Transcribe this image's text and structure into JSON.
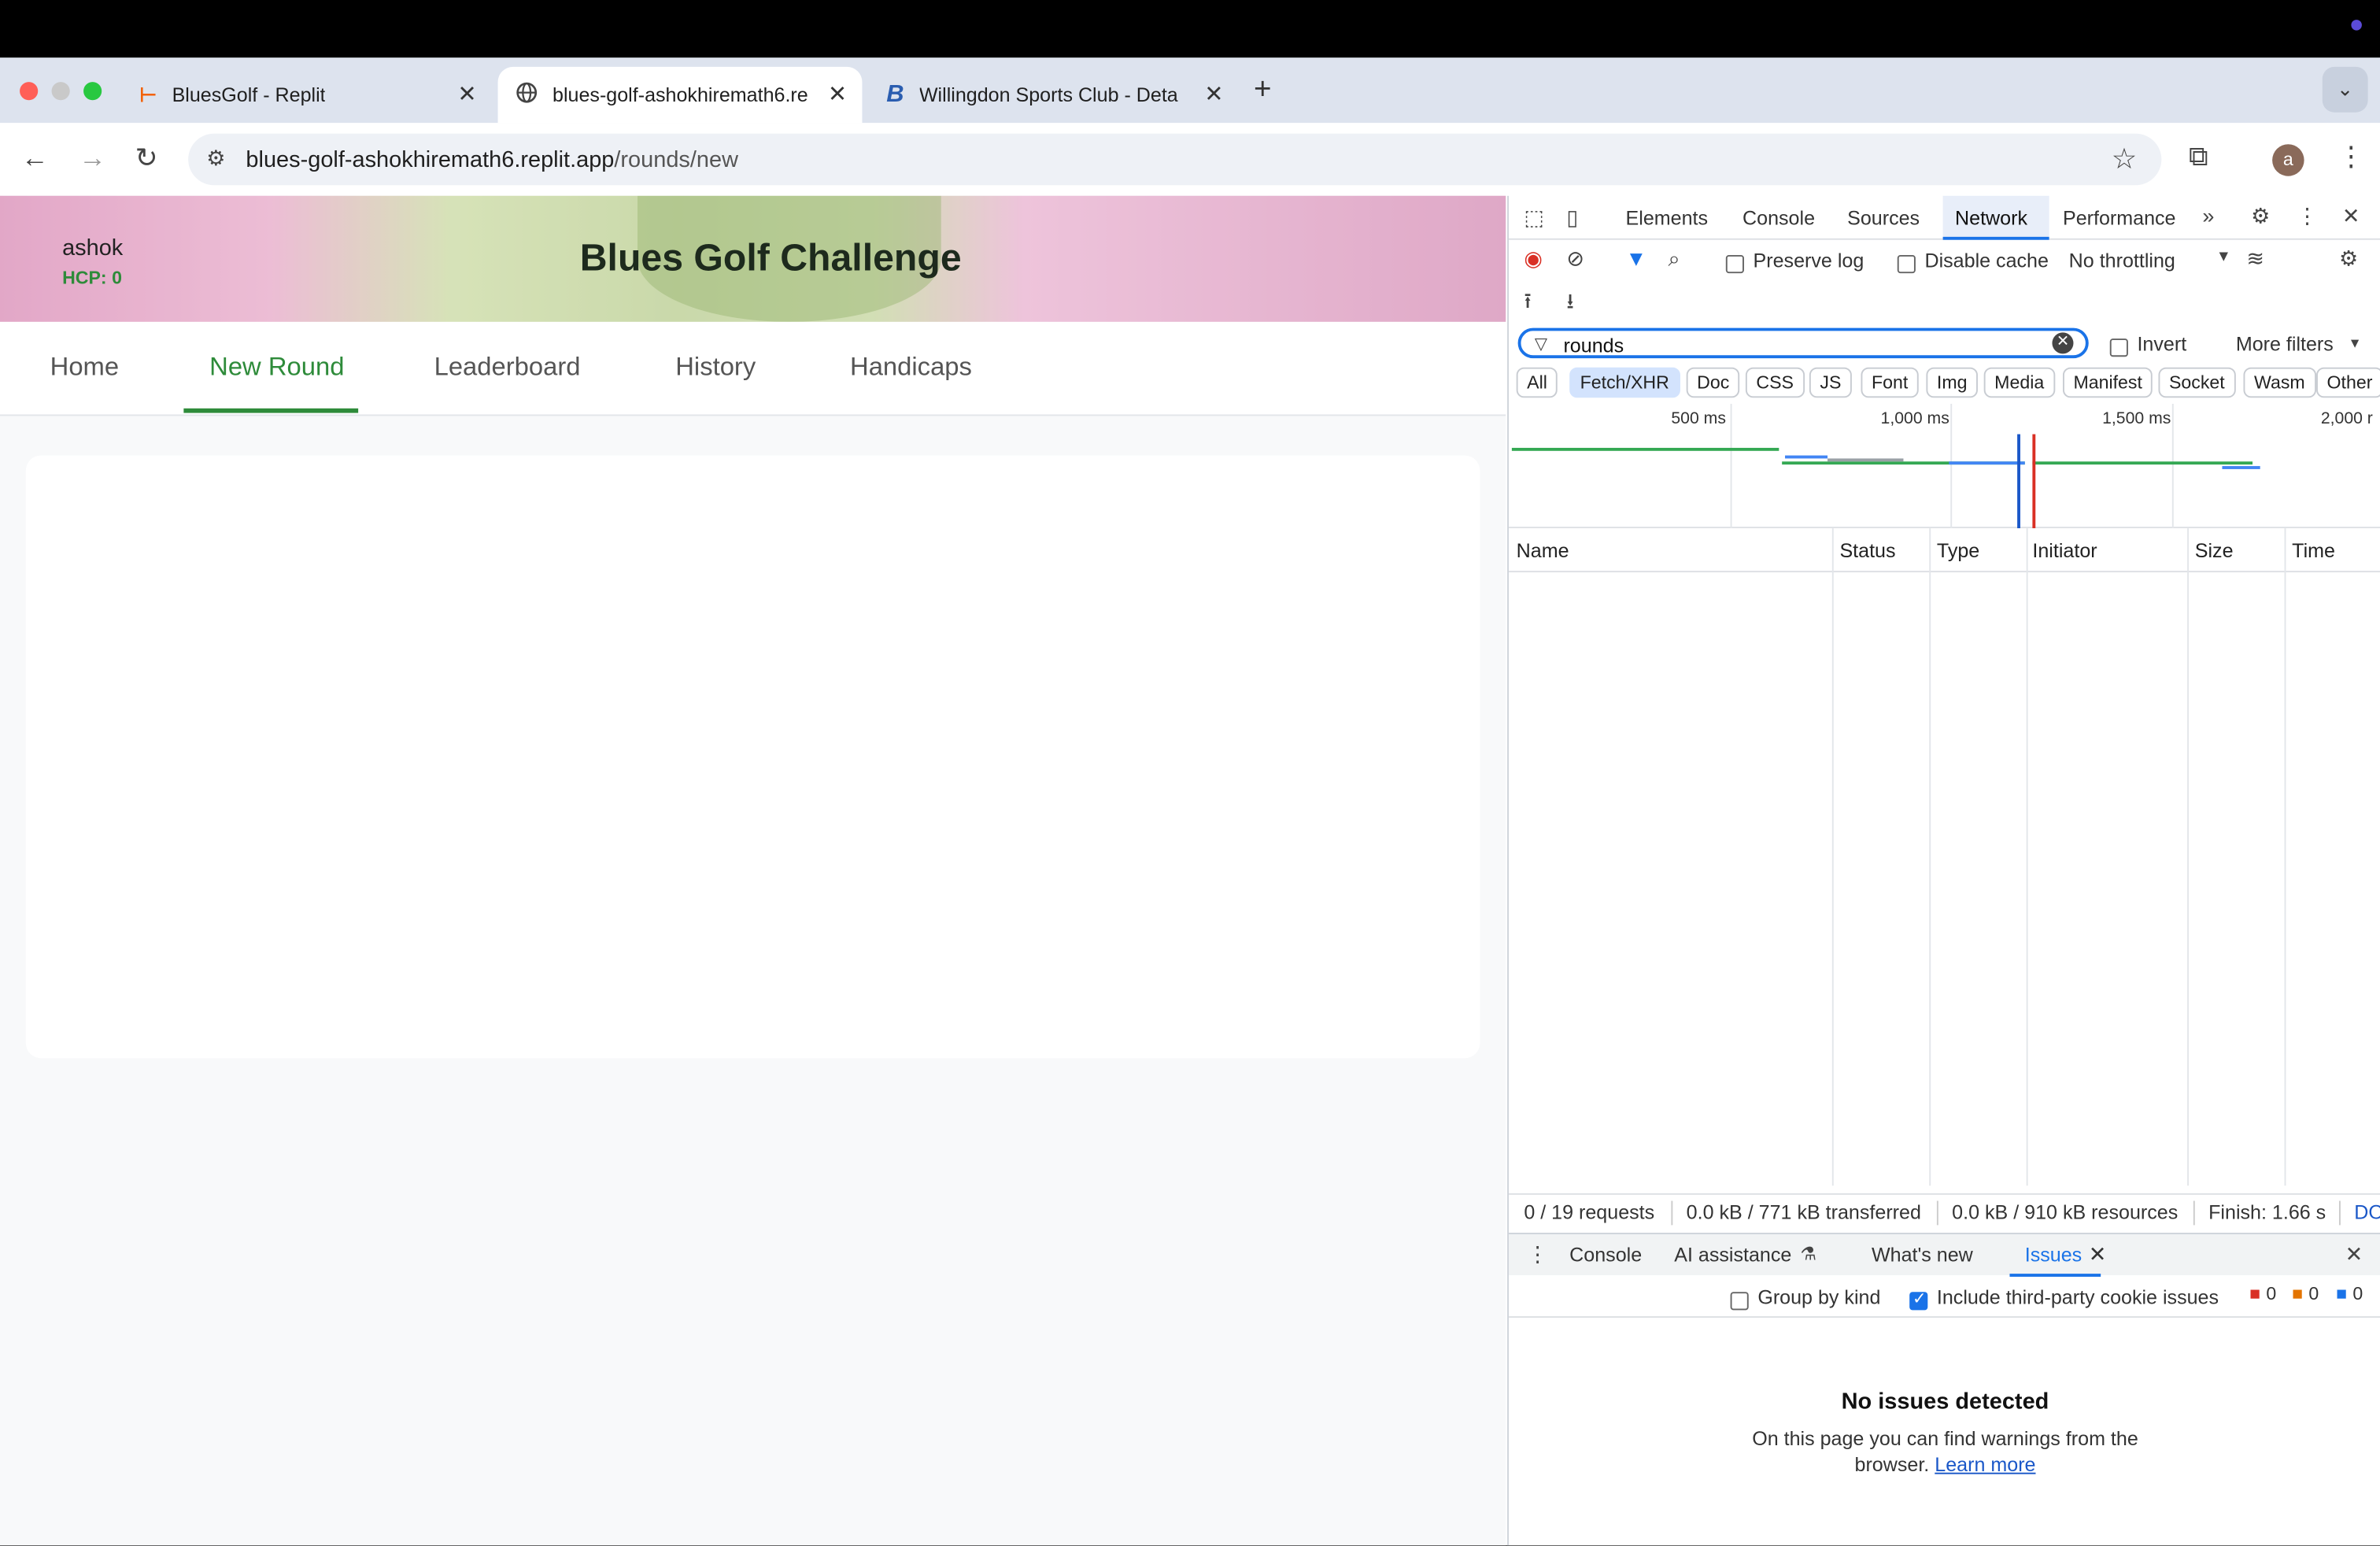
{
  "browser": {
    "tabs": [
      {
        "title": "BluesGolf - Replit",
        "favicon": "replit-icon"
      },
      {
        "title": "blues-golf-ashokhiremath6.re",
        "favicon": "globe-icon",
        "active": true
      },
      {
        "title": "Willingdon Sports Club - Deta",
        "favicon": "b-logo-icon"
      }
    ],
    "new_tab": "+",
    "url_host": "blues-golf-ashokhiremath6.replit.app",
    "url_path": "/rounds/new",
    "avatar_letter": "a"
  },
  "app": {
    "user_name": "ashok",
    "user_hcp": "HCP: 0",
    "title": "Blues Golf Challenge",
    "nav": [
      {
        "label": "Home"
      },
      {
        "label": "New Round",
        "active": true
      },
      {
        "label": "Leaderboard"
      },
      {
        "label": "History"
      },
      {
        "label": "Handicaps"
      }
    ],
    "accent_color": "#2e8b3a"
  },
  "devtools": {
    "tabs": [
      "Elements",
      "Console",
      "Sources",
      "Network",
      "Performance"
    ],
    "active_tab": "Network",
    "preserve_log": "Preserve log",
    "disable_cache": "Disable cache",
    "throttling": "No throttling",
    "filter_value": "rounds",
    "invert": "Invert",
    "more_filters": "More filters",
    "chips": [
      "All",
      "Fetch/XHR",
      "Doc",
      "CSS",
      "JS",
      "Font",
      "Img",
      "Media",
      "Manifest",
      "Socket",
      "Wasm",
      "Other"
    ],
    "active_chip": "Fetch/XHR",
    "timeline_labels": [
      "500 ms",
      "1,000 ms",
      "1,500 ms",
      "2,000 r"
    ],
    "columns": [
      "Name",
      "Status",
      "Type",
      "Initiator",
      "Size",
      "Time"
    ],
    "status": {
      "requests": "0 / 19 requests",
      "transferred": "0.0 kB / 771 kB transferred",
      "resources": "0.0 kB / 910 kB resources",
      "finish": "Finish: 1.66 s",
      "dom": "DO"
    },
    "drawer_tabs": [
      "Console",
      "AI assistance",
      "What's new",
      "Issues"
    ],
    "active_drawer_tab": "Issues",
    "group_by_kind": "Group by kind",
    "include_third_party": "Include third-party cookie issues",
    "counts": [
      "0",
      "0",
      "0"
    ],
    "no_issues_title": "No issues detected",
    "no_issues_body": "On this page you can find warnings from the browser.",
    "learn_more": "Learn more"
  }
}
